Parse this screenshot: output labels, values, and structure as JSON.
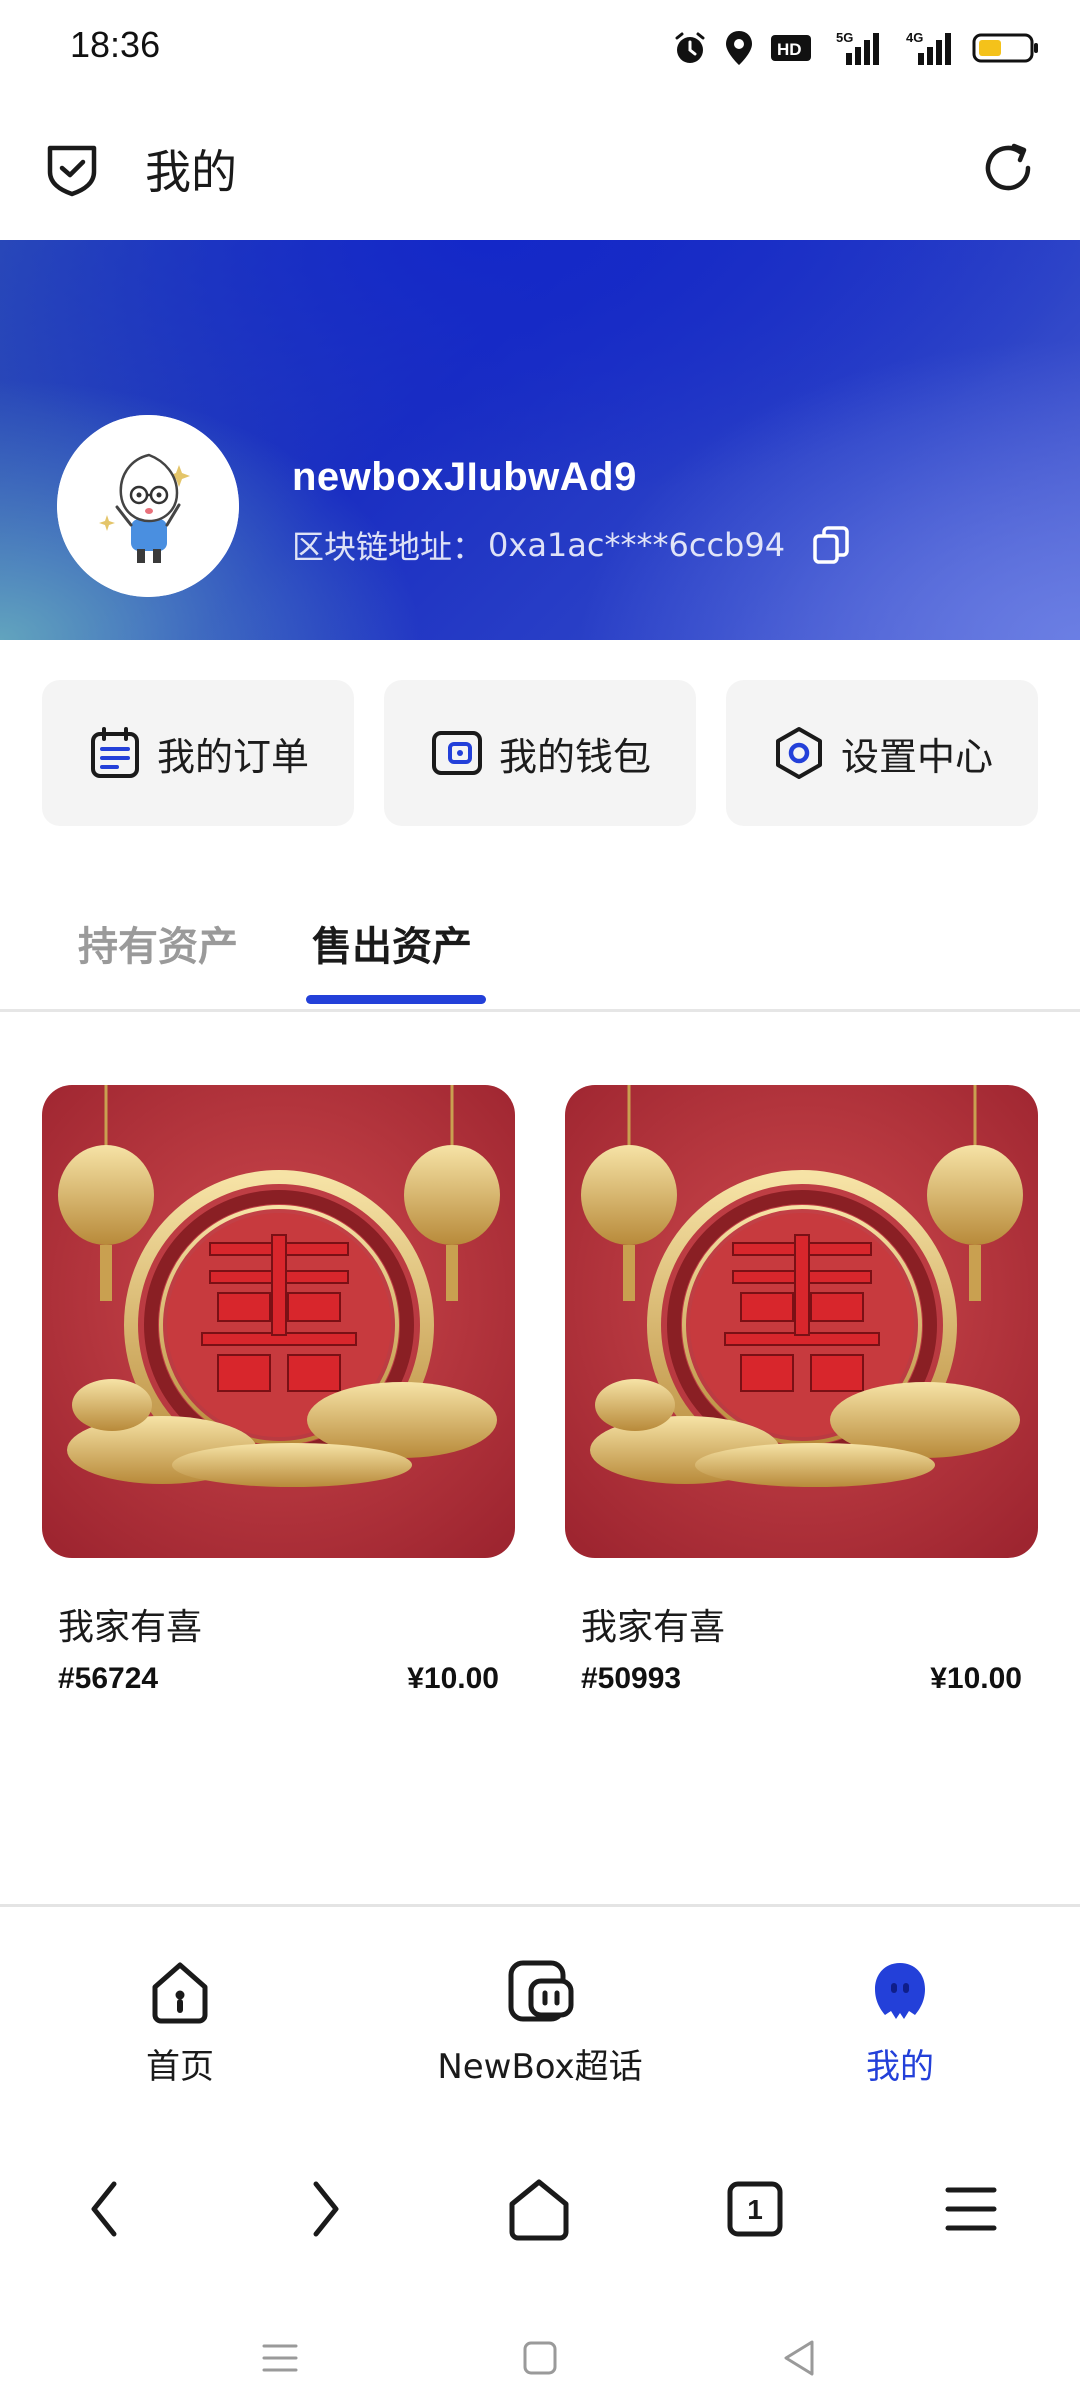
{
  "status_bar": {
    "time": "18:36",
    "icons": [
      "alarm-icon",
      "location-icon",
      "hd-icon",
      "5g-signal-icon",
      "4g-signal-icon",
      "battery-icon"
    ],
    "hd_text": "HD",
    "net1": "5G",
    "net2": "4G"
  },
  "header": {
    "title": "我的",
    "left_icon": "shield-check-icon",
    "right_icon": "refresh-icon"
  },
  "profile": {
    "username": "newboxJIubwAd9",
    "address_label": "区块链地址：",
    "address_value": "0xa1ac****6ccb94",
    "copy_icon": "copy-icon"
  },
  "quick_actions": [
    {
      "label": "我的订单",
      "icon": "calendar-order-icon"
    },
    {
      "label": "我的钱包",
      "icon": "wallet-icon"
    },
    {
      "label": "设置中心",
      "icon": "settings-hexagon-icon"
    }
  ],
  "tabs": {
    "holding": "持有资产",
    "sold": "售出资产",
    "active": "sold"
  },
  "products": [
    {
      "name": "我家有喜",
      "id": "#56724",
      "price": "¥10.00"
    },
    {
      "name": "我家有喜",
      "id": "#50993",
      "price": "¥10.00"
    }
  ],
  "bottom_nav": [
    {
      "label": "首页",
      "icon": "home-icon"
    },
    {
      "label": "NewBox超话",
      "icon": "chat-bubble-icon"
    },
    {
      "label": "我的",
      "icon": "profile-ghost-icon",
      "active": true
    }
  ],
  "browser_bar": {
    "tab_count": "1",
    "icons": [
      "back-icon",
      "forward-icon",
      "home-icon",
      "tabs-icon",
      "menu-icon"
    ]
  },
  "colors": {
    "accent": "#2340d9",
    "banner_dark": "#1a2ec2",
    "product_red": "#b8323a",
    "gold": "#d9b25a"
  }
}
